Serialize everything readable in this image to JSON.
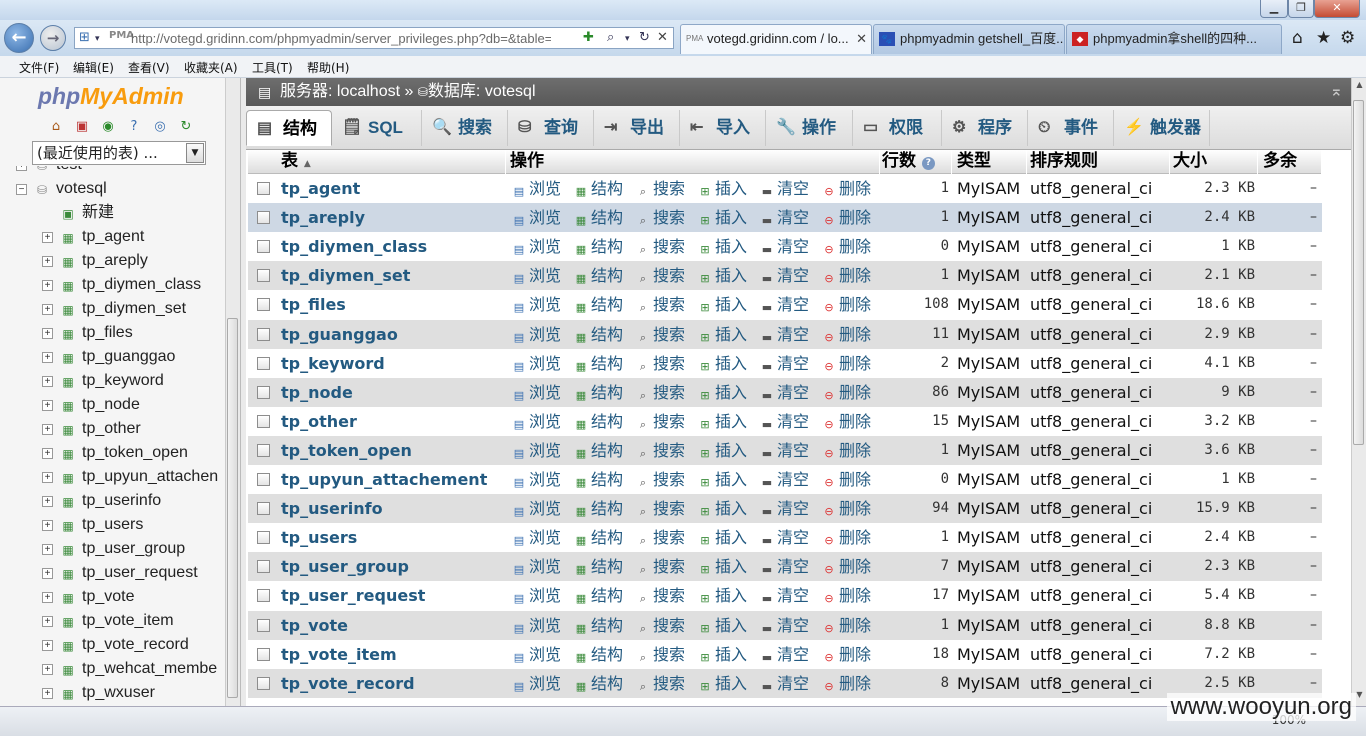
{
  "browser": {
    "url": "http://votegd.gridinn.com/phpmyadmin/server_privileges.php?db=&table=&",
    "tabs": [
      {
        "label": "votegd.gridinn.com / lo...",
        "active": true
      },
      {
        "label": "phpmyadmin getshell_百度...",
        "active": false
      },
      {
        "label": "phpmyadmin拿shell的四种...",
        "active": false
      }
    ],
    "menu": [
      "文件(F)",
      "编辑(E)",
      "查看(V)",
      "收藏夹(A)",
      "工具(T)",
      "帮助(H)"
    ],
    "zoom": "100%"
  },
  "sidebar": {
    "logo_php": "php",
    "logo_my": "MyAdmin",
    "recent": "(最近使用的表) ...",
    "tree": {
      "db_test": "test",
      "db_votesql": "votesql",
      "new": "新建",
      "tables": [
        "tp_agent",
        "tp_areply",
        "tp_diymen_class",
        "tp_diymen_set",
        "tp_files",
        "tp_guanggao",
        "tp_keyword",
        "tp_node",
        "tp_other",
        "tp_token_open",
        "tp_upyun_attachen",
        "tp_userinfo",
        "tp_users",
        "tp_user_group",
        "tp_user_request",
        "tp_vote",
        "tp_vote_item",
        "tp_vote_record",
        "tp_wehcat_membe",
        "tp_wxuser"
      ]
    }
  },
  "breadcrumb": {
    "server": "服务器: localhost",
    "sep": "»",
    "database": "数据库: votesql"
  },
  "tabs": [
    "结构",
    "SQL",
    "搜索",
    "查询",
    "导出",
    "导入",
    "操作",
    "权限",
    "程序",
    "事件",
    "触发器"
  ],
  "table_headers": {
    "table": "表",
    "sort_indicator": "▲",
    "actions": "操作",
    "rows": "行数",
    "type": "类型",
    "collation": "排序规则",
    "size": "大小",
    "overhead": "多余"
  },
  "actions": {
    "browse": "浏览",
    "structure": "结构",
    "search": "搜索",
    "insert": "插入",
    "empty": "清空",
    "drop": "删除"
  },
  "rows": [
    {
      "name": "tp_agent",
      "rows": "1",
      "type": "MyISAM",
      "collation": "utf8_general_ci",
      "size": "2.3 KB",
      "overhead": "–"
    },
    {
      "name": "tp_areply",
      "rows": "1",
      "type": "MyISAM",
      "collation": "utf8_general_ci",
      "size": "2.4 KB",
      "overhead": "–"
    },
    {
      "name": "tp_diymen_class",
      "rows": "0",
      "type": "MyISAM",
      "collation": "utf8_general_ci",
      "size": "1 KB",
      "overhead": "–"
    },
    {
      "name": "tp_diymen_set",
      "rows": "1",
      "type": "MyISAM",
      "collation": "utf8_general_ci",
      "size": "2.1 KB",
      "overhead": "–"
    },
    {
      "name": "tp_files",
      "rows": "108",
      "type": "MyISAM",
      "collation": "utf8_general_ci",
      "size": "18.6 KB",
      "overhead": "–"
    },
    {
      "name": "tp_guanggao",
      "rows": "11",
      "type": "MyISAM",
      "collation": "utf8_general_ci",
      "size": "2.9 KB",
      "overhead": "–"
    },
    {
      "name": "tp_keyword",
      "rows": "2",
      "type": "MyISAM",
      "collation": "utf8_general_ci",
      "size": "4.1 KB",
      "overhead": "–"
    },
    {
      "name": "tp_node",
      "rows": "86",
      "type": "MyISAM",
      "collation": "utf8_general_ci",
      "size": "9 KB",
      "overhead": "–"
    },
    {
      "name": "tp_other",
      "rows": "15",
      "type": "MyISAM",
      "collation": "utf8_general_ci",
      "size": "3.2 KB",
      "overhead": "–"
    },
    {
      "name": "tp_token_open",
      "rows": "1",
      "type": "MyISAM",
      "collation": "utf8_general_ci",
      "size": "3.6 KB",
      "overhead": "–"
    },
    {
      "name": "tp_upyun_attachement",
      "rows": "0",
      "type": "MyISAM",
      "collation": "utf8_general_ci",
      "size": "1 KB",
      "overhead": "–"
    },
    {
      "name": "tp_userinfo",
      "rows": "94",
      "type": "MyISAM",
      "collation": "utf8_general_ci",
      "size": "15.9 KB",
      "overhead": "–"
    },
    {
      "name": "tp_users",
      "rows": "1",
      "type": "MyISAM",
      "collation": "utf8_general_ci",
      "size": "2.4 KB",
      "overhead": "–"
    },
    {
      "name": "tp_user_group",
      "rows": "7",
      "type": "MyISAM",
      "collation": "utf8_general_ci",
      "size": "2.3 KB",
      "overhead": "–"
    },
    {
      "name": "tp_user_request",
      "rows": "17",
      "type": "MyISAM",
      "collation": "utf8_general_ci",
      "size": "5.4 KB",
      "overhead": "–"
    },
    {
      "name": "tp_vote",
      "rows": "1",
      "type": "MyISAM",
      "collation": "utf8_general_ci",
      "size": "8.8 KB",
      "overhead": "–"
    },
    {
      "name": "tp_vote_item",
      "rows": "18",
      "type": "MyISAM",
      "collation": "utf8_general_ci",
      "size": "7.2 KB",
      "overhead": "–"
    },
    {
      "name": "tp_vote_record",
      "rows": "8",
      "type": "MyISAM",
      "collation": "utf8_general_ci",
      "size": "2.5 KB",
      "overhead": "–"
    }
  ],
  "watermark": "www.wooyun.org"
}
